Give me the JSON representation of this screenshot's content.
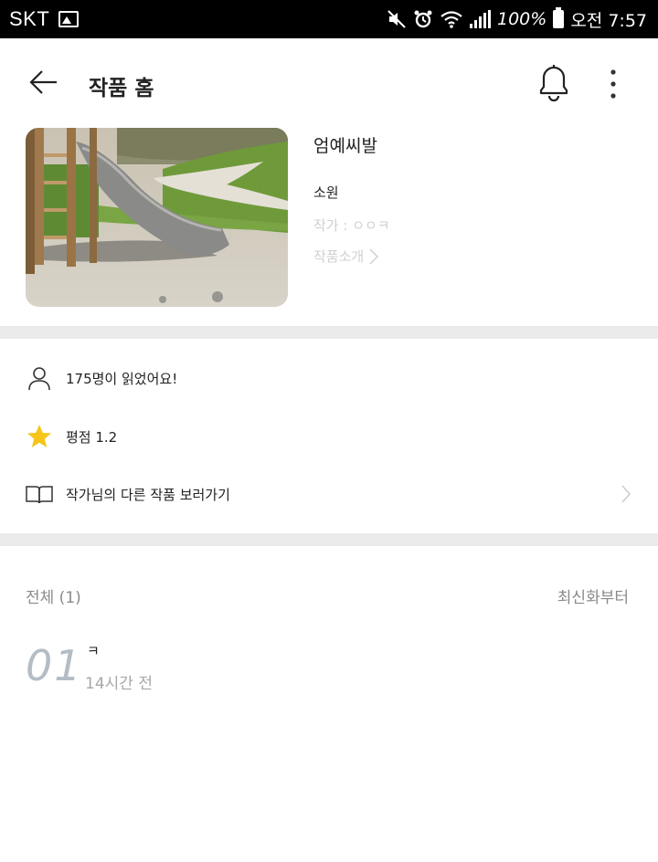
{
  "status_bar": {
    "carrier": "SKT",
    "battery": "100%",
    "time": "오전 7:57"
  },
  "header": {
    "title": "작품 홈"
  },
  "work": {
    "title": "엄예씨발",
    "genre": "소원",
    "author": "작가 : ㅇㅇㅋ",
    "intro_link": "작품소개"
  },
  "stats": {
    "readers": "175명이 읽었어요!",
    "rating": "평점 1.2",
    "other_works": "작가님의 다른 작품 보러가기"
  },
  "list": {
    "count_label": "전체 (1)",
    "sort_label": "최신화부터",
    "episodes": [
      {
        "number": "01",
        "title": "ㅋ",
        "time": "14시간 전"
      }
    ]
  },
  "colors": {
    "accent_star": "#f5c518",
    "divider": "#ebebeb",
    "episode_number": "#b4bcc4"
  }
}
